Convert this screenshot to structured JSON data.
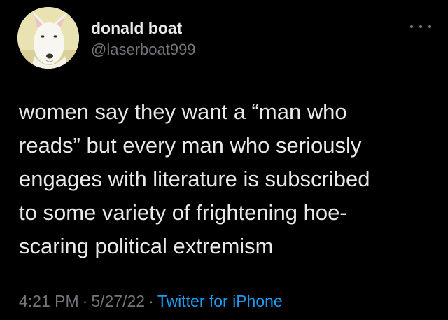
{
  "tweet": {
    "author": {
      "display_name": "donald boat",
      "handle": "@laserboat999",
      "avatar_icon": "bull-terrier-avatar"
    },
    "lines": [
      "women say they want a “man who",
      "reads” but every man who seriously",
      "engages with literature is subscribed",
      "to some variety of frightening hoe-",
      "scaring political extremism"
    ],
    "time": "4:21 PM",
    "date": "5/27/22",
    "separator": "·",
    "source": "Twitter for iPhone",
    "more_icon": "more-options-icon"
  },
  "colors": {
    "background": "#000000",
    "text_primary": "#e7e9ea",
    "text_secondary": "#71767b",
    "link": "#1d9bf0"
  }
}
